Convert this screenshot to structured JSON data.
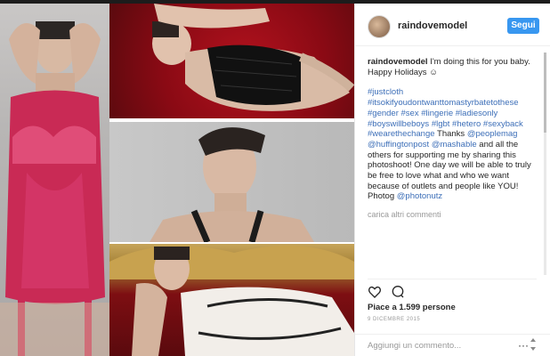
{
  "post": {
    "username": "raindovemodel",
    "follow_label": "Segui",
    "caption": {
      "author": "raindovemodel",
      "text": "I'm doing this for you baby. Happy Holidays",
      "emoji": "☺",
      "hashtags": "#justcloth #itsokifyoudontwanttomastyrbatetothese #gender #sex #lingerie #ladiesonly #boyswillbeboys #lgbt #hetero #sexyback #wearethechange",
      "thanks_prefix": "Thanks",
      "mention_1": "@peoplemag",
      "mention_2": "@huffingtonpost",
      "mention_3": "@mashable",
      "mid_text": "and all the others for supporting me by sharing this photoshoot! One day we will be able to truly be free to love what and who we want because of outlets and people like YOU! Photog",
      "mention_4": "@photonutz"
    },
    "load_more": "carica altri commenti",
    "likes": "Piace a 1.599 persone",
    "date": "9 DICEMBRE 2015",
    "add_comment_placeholder": "Aggiungi un commento...",
    "more_icon": "···"
  },
  "icons": {
    "like": "heart-icon",
    "comment": "comment-icon",
    "options": "ellipsis-icon"
  },
  "colors": {
    "accent": "#3897f0",
    "link": "#3d6fb8",
    "text": "#262626",
    "muted": "#999999"
  }
}
